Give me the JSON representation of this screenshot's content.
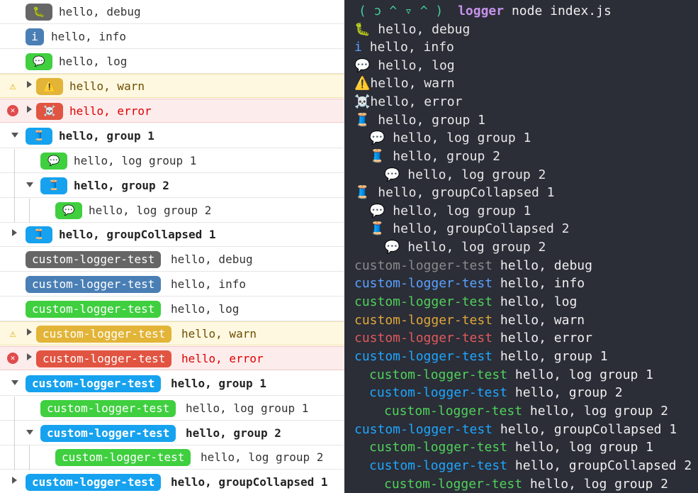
{
  "console": {
    "simple": {
      "debug": {
        "emoji": "🐛",
        "text": "hello, debug"
      },
      "info": {
        "emoji": "i",
        "text": "hello, info"
      },
      "log": {
        "emoji": "💬",
        "text": "hello, log"
      },
      "warn": {
        "emoji": "⚠️",
        "text": "hello, warn"
      },
      "error": {
        "emoji": "☠️",
        "text": "hello, error"
      },
      "group1": {
        "emoji": "🧵",
        "text": "hello, group 1"
      },
      "log_g1": {
        "emoji": "💬",
        "text": "hello, log group 1"
      },
      "group2": {
        "emoji": "🧵",
        "text": "hello, group 2"
      },
      "log_g2": {
        "emoji": "💬",
        "text": "hello, log group 2"
      },
      "gc1": {
        "emoji": "🧵",
        "text": "hello, groupCollapsed 1"
      }
    },
    "custom": {
      "badge": "custom-logger-test",
      "debug": "hello, debug",
      "info": "hello, info",
      "log": "hello, log",
      "warn": "hello, warn",
      "error": "hello, error",
      "group1": "hello, group 1",
      "log_g1": "hello, log group 1",
      "group2": "hello, group 2",
      "log_g2": "hello, log group 2",
      "gc1": "hello, groupCollapsed 1"
    },
    "warn_icon": "warning-icon",
    "error_icon": "error-icon"
  },
  "terminal": {
    "prompt_face": "( ɔ ^ ▿ ^ )",
    "prompt_cmd": "logger",
    "prompt_args": "node index.js",
    "lines": [
      {
        "emoji": "🐛",
        "text": "hello, debug"
      },
      {
        "emoji": "i",
        "text": "hello, info"
      },
      {
        "emoji": "💬",
        "text": "hello, log"
      },
      {
        "emoji": "⚠️",
        "text": "hello, warn"
      },
      {
        "emoji": "☠️",
        "text": "hello, error"
      },
      {
        "emoji": "🧵",
        "text": "hello, group 1"
      },
      {
        "emoji": "💬",
        "text": "hello, log group 1"
      },
      {
        "emoji": "🧵",
        "text": "hello, group 2"
      },
      {
        "emoji": "💬",
        "text": "hello, log group 2"
      },
      {
        "emoji": "🧵",
        "text": "hello, groupCollapsed 1"
      },
      {
        "emoji": "💬",
        "text": "hello, log group 1"
      },
      {
        "emoji": "🧵",
        "text": "hello, groupCollapsed 2"
      },
      {
        "emoji": "💬",
        "text": "hello, log group 2"
      }
    ],
    "custom_badge": "custom-logger-test",
    "custom_lines": [
      "hello, debug",
      "hello, info",
      "hello, log",
      "hello, warn",
      "hello, error",
      "hello, group 1",
      "hello, log group 1",
      "hello, group 2",
      "hello, log group 2",
      "hello, groupCollapsed 1",
      "hello, log group 1",
      "hello, groupCollapsed 2",
      "hello, log group 2"
    ]
  },
  "colors": {
    "debug": "#666666",
    "info": "#4a7fb5",
    "log": "#3fcf3f",
    "warn": "#e2b437",
    "error": "#e15441",
    "group": "#16a2ef",
    "terminal_bg": "#2b2d37"
  }
}
